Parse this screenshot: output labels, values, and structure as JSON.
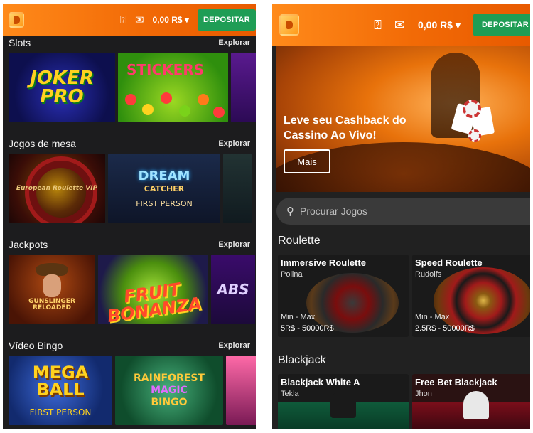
{
  "left": {
    "balance": "0,00 R$ ▾",
    "deposit": "DEPOSITAR",
    "sections": [
      {
        "title": "Slots",
        "explore": "Explorar",
        "tiles": [
          "JOKER PRO",
          "STICKERS"
        ]
      },
      {
        "title": "Jogos de mesa",
        "explore": "Explorar",
        "tiles": [
          "European Roulette VIP",
          "DREAM",
          "CATCHER",
          "FIRST PERSON"
        ]
      },
      {
        "title": "Jackpots",
        "explore": "Explorar",
        "tiles": [
          "GUNSLINGER RELOADED",
          "FRUIT BONANZA",
          "ABS"
        ]
      },
      {
        "title": "Vídeo Bingo",
        "explore": "Explorar",
        "tiles": [
          "MEGA BALL",
          "FIRST PERSON",
          "RAINFOREST",
          "MAGIC",
          "BINGO"
        ]
      }
    ]
  },
  "right": {
    "balance": "0,00 R$ ▾",
    "deposit": "DEPOSITAR",
    "hero_title": "Leve seu Cashback do Cassino Ao Vivo!",
    "hero_button": "Mais",
    "search_placeholder": "Procurar Jogos",
    "roulette_title": "Roulette",
    "roulette": [
      {
        "name": "Immersive Roulette",
        "dealer": "Polina",
        "minmax": "Min - Max",
        "limits": "5R$ - 50000R$"
      },
      {
        "name": "Speed Roulette",
        "dealer": "Rudolfs",
        "minmax": "Min - Max",
        "limits": "2.5R$ - 50000R$"
      }
    ],
    "blackjack_title": "Blackjack",
    "blackjack": [
      {
        "name": "Blackjack White A",
        "dealer": "Tekla"
      },
      {
        "name": "Free Bet Blackjack",
        "dealer": "Jhon"
      }
    ]
  },
  "colors": {
    "brand": "#f26a06",
    "deposit": "#1f9d55",
    "bg": "#1c1c1e"
  },
  "icons": [
    "support-icon",
    "mail-icon",
    "search-icon"
  ]
}
